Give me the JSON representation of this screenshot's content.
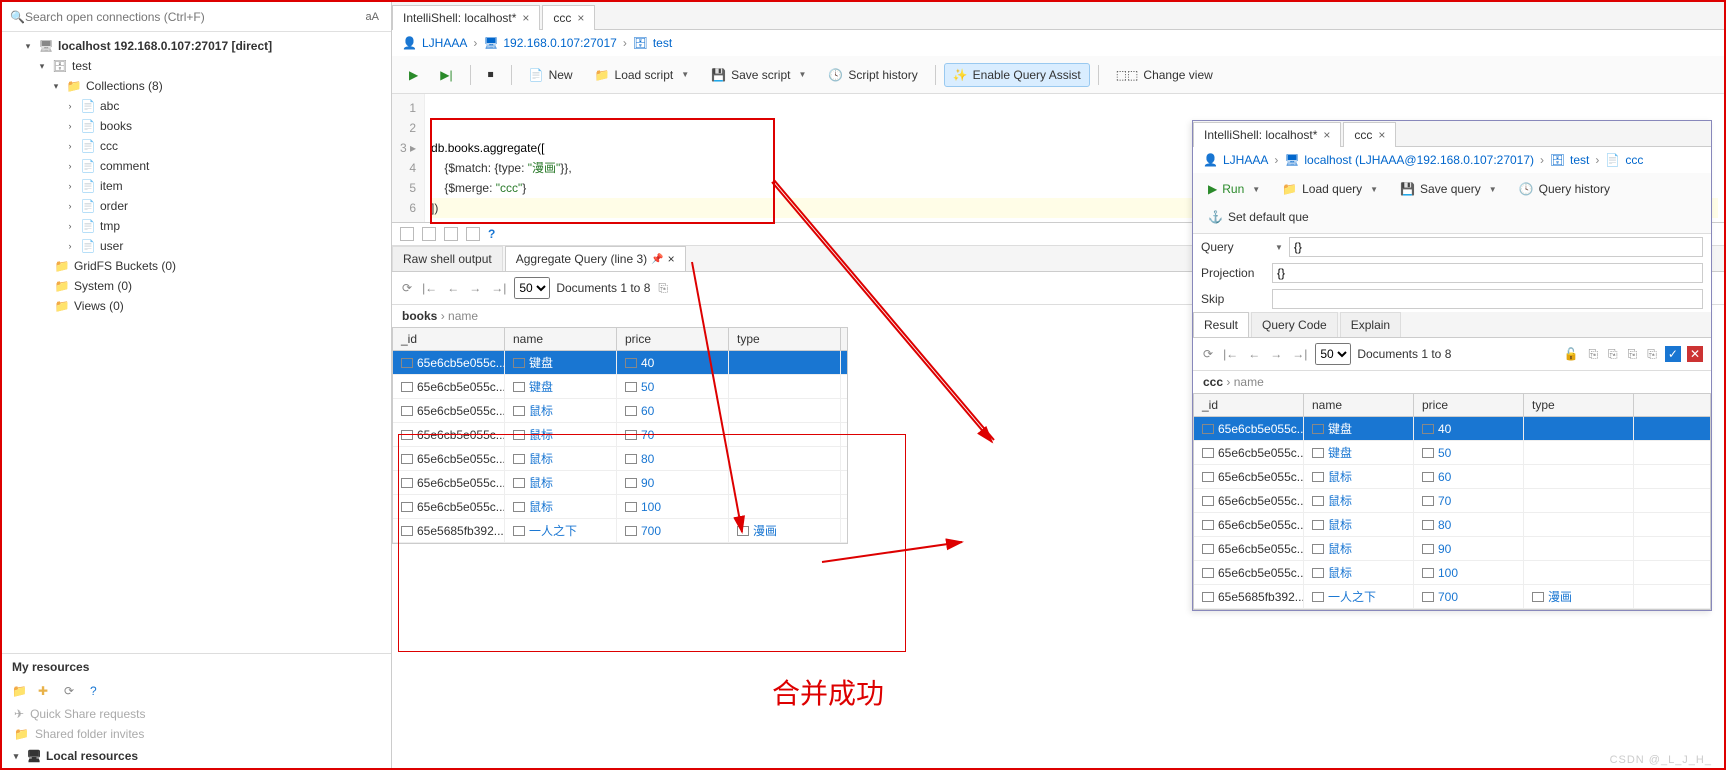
{
  "sidebar": {
    "search_placeholder": "Search open connections (Ctrl+F)",
    "aA": "aA",
    "conn": "localhost 192.168.0.107:27017 [direct]",
    "db": "test",
    "collections_label": "Collections (8)",
    "collections": [
      "abc",
      "books",
      "ccc",
      "comment",
      "item",
      "order",
      "tmp",
      "user"
    ],
    "gridfs": "GridFS Buckets (0)",
    "system": "System (0)",
    "views": "Views (0)",
    "my_resources": "My resources",
    "quick_share": "Quick Share requests",
    "folder_invites": "Shared folder invites",
    "local_resources": "Local resources"
  },
  "tabs": {
    "t1": "IntelliShell: localhost*",
    "t2": "ccc"
  },
  "breadcrumb": {
    "user": "LJHAAA",
    "host": "192.168.0.107:27017",
    "db": "test"
  },
  "toolbar": {
    "new": "New",
    "load": "Load script",
    "save": "Save script",
    "history": "Script history",
    "assist": "Enable Query Assist",
    "changeview": "Change view"
  },
  "editor": {
    "lines": [
      "1",
      "2",
      "3",
      "4",
      "5",
      "6"
    ],
    "l3a": "db.books.aggregate([",
    "l4": "    {$match: {type: ",
    "l4s": "\"漫画\"",
    "l4e": "}},",
    "l5": "    {$merge: ",
    "l5s": "\"ccc\"",
    "l5e": "}",
    "l6": "])"
  },
  "result": {
    "tab1": "Raw shell output",
    "tab2": "Aggregate Query (line 3)",
    "page_size": "50",
    "docs": "Documents 1 to 8",
    "path_main": "books",
    "path_sub": "name",
    "headers": [
      "_id",
      "name",
      "price",
      "type"
    ],
    "rows": [
      {
        "id": "65e6cb5e055c...",
        "name": "键盘",
        "price": "40",
        "type": ""
      },
      {
        "id": "65e6cb5e055c...",
        "name": "键盘",
        "price": "50",
        "type": ""
      },
      {
        "id": "65e6cb5e055c...",
        "name": "鼠标",
        "price": "60",
        "type": ""
      },
      {
        "id": "65e6cb5e055c...",
        "name": "鼠标",
        "price": "70",
        "type": ""
      },
      {
        "id": "65e6cb5e055c...",
        "name": "鼠标",
        "price": "80",
        "type": ""
      },
      {
        "id": "65e6cb5e055c...",
        "name": "鼠标",
        "price": "90",
        "type": ""
      },
      {
        "id": "65e6cb5e055c...",
        "name": "鼠标",
        "price": "100",
        "type": ""
      },
      {
        "id": "65e5685fb392...",
        "name": "一人之下",
        "price": "700",
        "type": "漫画"
      }
    ]
  },
  "panel": {
    "tab1": "IntelliShell: localhost*",
    "tab2": "ccc",
    "bc_user": "LJHAAA",
    "bc_host": "localhost (LJHAAA@192.168.0.107:27017)",
    "bc_db": "test",
    "bc_coll": "ccc",
    "run": "Run",
    "load": "Load query",
    "save": "Save query",
    "history": "Query history",
    "default": "Set default que",
    "query_lbl": "Query",
    "query_val": "{}",
    "proj_lbl": "Projection",
    "proj_val": "{}",
    "skip_lbl": "Skip",
    "rtab1": "Result",
    "rtab2": "Query Code",
    "rtab3": "Explain",
    "page_size": "50",
    "docs": "Documents 1 to 8",
    "path_main": "ccc",
    "path_sub": "name",
    "headers": [
      "_id",
      "name",
      "price",
      "type"
    ],
    "rows": [
      {
        "id": "65e6cb5e055c...",
        "name": "键盘",
        "price": "40",
        "type": ""
      },
      {
        "id": "65e6cb5e055c...",
        "name": "键盘",
        "price": "50",
        "type": ""
      },
      {
        "id": "65e6cb5e055c...",
        "name": "鼠标",
        "price": "60",
        "type": ""
      },
      {
        "id": "65e6cb5e055c...",
        "name": "鼠标",
        "price": "70",
        "type": ""
      },
      {
        "id": "65e6cb5e055c...",
        "name": "鼠标",
        "price": "80",
        "type": ""
      },
      {
        "id": "65e6cb5e055c...",
        "name": "鼠标",
        "price": "90",
        "type": ""
      },
      {
        "id": "65e6cb5e055c...",
        "name": "鼠标",
        "price": "100",
        "type": ""
      },
      {
        "id": "65e5685fb392...",
        "name": "一人之下",
        "price": "700",
        "type": "漫画"
      }
    ]
  },
  "annotation": "合并成功",
  "watermark": "CSDN @_L_J_H_"
}
